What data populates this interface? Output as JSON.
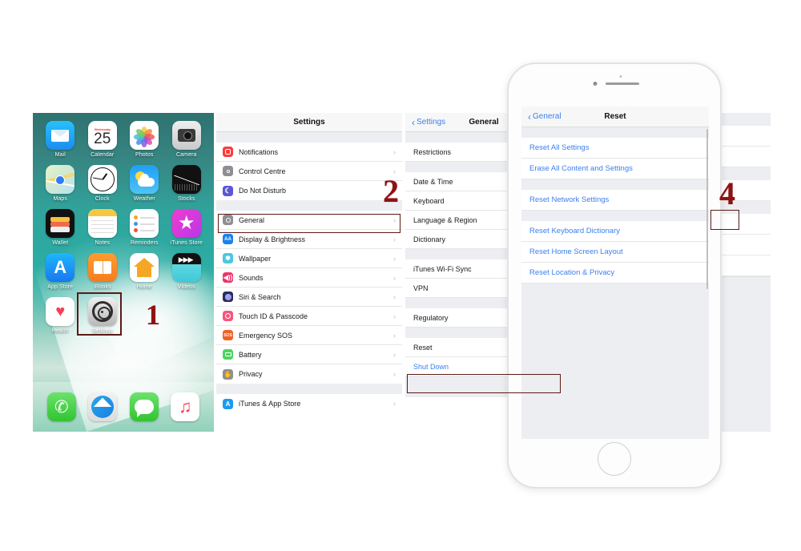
{
  "home_screen": {
    "apps": [
      {
        "label": "Mail",
        "icon": "mail-icon"
      },
      {
        "label": "Calendar",
        "icon": "calendar-icon",
        "weekday": "Wednesday",
        "day": "25"
      },
      {
        "label": "Photos",
        "icon": "photos-icon"
      },
      {
        "label": "Camera",
        "icon": "camera-icon"
      },
      {
        "label": "Maps",
        "icon": "maps-icon"
      },
      {
        "label": "Clock",
        "icon": "clock-icon"
      },
      {
        "label": "Weather",
        "icon": "weather-icon"
      },
      {
        "label": "Stocks",
        "icon": "stocks-icon"
      },
      {
        "label": "Wallet",
        "icon": "wallet-icon"
      },
      {
        "label": "Notes",
        "icon": "notes-icon"
      },
      {
        "label": "Reminders",
        "icon": "reminders-icon"
      },
      {
        "label": "iTunes Store",
        "icon": "itunes-store-icon"
      },
      {
        "label": "App Store",
        "icon": "app-store-icon"
      },
      {
        "label": "iBooks",
        "icon": "ibooks-icon"
      },
      {
        "label": "Home",
        "icon": "home-app-icon"
      },
      {
        "label": "Videos",
        "icon": "videos-icon"
      },
      {
        "label": "Health",
        "icon": "health-icon"
      },
      {
        "label": "Settings",
        "icon": "settings-gear-icon"
      }
    ],
    "dock": [
      {
        "label": "Phone",
        "icon": "phone-icon"
      },
      {
        "label": "Safari",
        "icon": "safari-compass-icon"
      },
      {
        "label": "Messages",
        "icon": "messages-bubble-icon"
      },
      {
        "label": "Music",
        "icon": "music-note-icon"
      }
    ]
  },
  "settings_panel": {
    "title": "Settings",
    "groups": [
      {
        "rows": [
          {
            "label": "Notifications",
            "icon": "notifications-icon",
            "color": "#fc3b3b",
            "chevron": true
          },
          {
            "label": "Control Centre",
            "icon": "control-centre-icon",
            "color": "#8e8e93",
            "chevron": true
          },
          {
            "label": "Do Not Disturb",
            "icon": "do-not-disturb-icon",
            "color": "#5b58d6",
            "chevron": true
          }
        ]
      },
      {
        "rows": [
          {
            "label": "General",
            "icon": "general-icon",
            "color": "#8e8e93",
            "chevron": true,
            "highlighted": true
          },
          {
            "label": "Display & Brightness",
            "icon": "display-brightness-icon",
            "color": "#1a82f0",
            "chevron": true
          },
          {
            "label": "Wallpaper",
            "icon": "wallpaper-icon",
            "color": "#4ec6e0",
            "chevron": true
          },
          {
            "label": "Sounds",
            "icon": "sounds-icon",
            "color": "#f0336a",
            "chevron": true
          },
          {
            "label": "Siri & Search",
            "icon": "siri-search-icon",
            "color": "#2b2b5e",
            "chevron": true
          },
          {
            "label": "Touch ID & Passcode",
            "icon": "touch-id-icon",
            "color": "#f5567c",
            "chevron": true
          },
          {
            "label": "Emergency SOS",
            "icon": "emergency-sos-icon",
            "color": "#f06124",
            "chevron": true
          },
          {
            "label": "Battery",
            "icon": "battery-icon",
            "color": "#4cd561",
            "chevron": true
          },
          {
            "label": "Privacy",
            "icon": "privacy-hand-icon",
            "color": "#8e8e93",
            "chevron": true
          }
        ]
      },
      {
        "rows": [
          {
            "label": "iTunes & App Store",
            "icon": "itunes-app-store-icon",
            "color": "#1a9af0",
            "chevron": true
          }
        ]
      }
    ]
  },
  "general_panel": {
    "back_label": "Settings",
    "title": "General",
    "groups": [
      {
        "rows": [
          {
            "label": "Restrictions",
            "chevron": true
          }
        ]
      },
      {
        "rows": [
          {
            "label": "Date & Time",
            "chevron": true
          },
          {
            "label": "Keyboard",
            "chevron": true
          },
          {
            "label": "Language & Region",
            "chevron": true
          },
          {
            "label": "Dictionary",
            "chevron": true
          }
        ]
      },
      {
        "rows": [
          {
            "label": "iTunes Wi-Fi Sync",
            "chevron": true
          },
          {
            "label": "VPN",
            "chevron": true
          }
        ]
      },
      {
        "rows": [
          {
            "label": "Regulatory",
            "chevron": true
          }
        ]
      },
      {
        "rows": [
          {
            "label": "Reset",
            "chevron": true,
            "highlighted": true
          },
          {
            "label": "Shut Down",
            "blue": true
          }
        ]
      }
    ]
  },
  "reset_panel": {
    "back_label": "General",
    "title": "Reset",
    "groups": [
      {
        "rows": [
          {
            "label": "Reset All Settings",
            "blue": true
          },
          {
            "label": "Erase All Content and Settings",
            "blue": true
          }
        ]
      },
      {
        "rows": [
          {
            "label": "Reset Network Settings",
            "blue": true
          }
        ]
      },
      {
        "rows": [
          {
            "label": "Reset Keyboard Dictionary",
            "blue": true
          },
          {
            "label": "Reset Home Screen Layout",
            "blue": true
          },
          {
            "label": "Reset Location & Privacy",
            "blue": true
          }
        ]
      }
    ]
  },
  "markers": {
    "one": "1",
    "two": "2",
    "four": "4"
  },
  "colors": {
    "marker_red": "#8f1213",
    "callout_border": "#5c1a14",
    "ios_blue": "#3b7ff0",
    "group_bg": "#eceef2"
  }
}
